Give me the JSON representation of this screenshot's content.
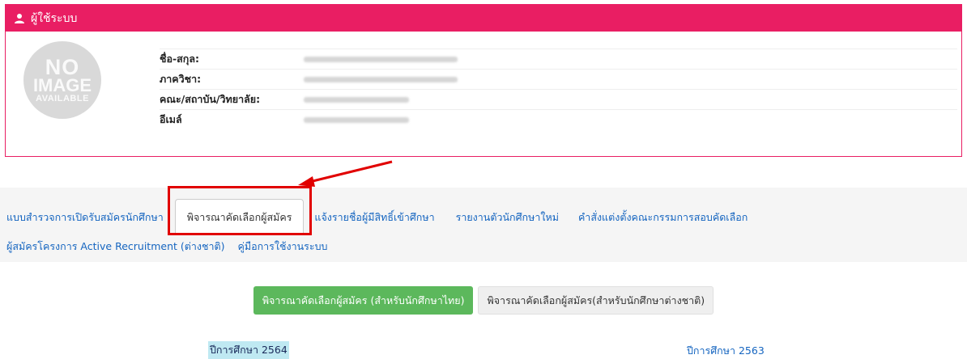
{
  "user_panel": {
    "header": "ผู้ใช้ระบบ",
    "photo": {
      "line1": "NO",
      "line2": "IMAGE",
      "line3": "AVAILABLE"
    },
    "fields": [
      {
        "label": "ชื่อ-สกุล:"
      },
      {
        "label": "ภาควิชา:"
      },
      {
        "label": "คณะ/สถาบัน/วิทยาลัย:"
      },
      {
        "label": "อีเมล์"
      }
    ]
  },
  "tabs": {
    "row1": [
      "แบบสำรวจการเปิดรับสมัครนักศึกษา",
      "พิจารณาคัดเลือกผู้สมัคร",
      "แจ้งรายชื่อผู้มีสิทธิ์เข้าศึกษา",
      "รายงานตัวนักศึกษาใหม่",
      "คำสั่งแต่งตั้งคณะกรรมการสอบคัดเลือก"
    ],
    "row2": [
      "ผู้สมัครโครงการ Active Recruitment (ต่างชาติ)",
      "คู่มือการใช้งานระบบ"
    ],
    "active_index": 1
  },
  "buttons": {
    "thai": "พิจารณาคัดเลือกผู้สมัคร (สำหรับนักศึกษาไทย)",
    "foreign": "พิจารณาคัดเลือกผู้สมัคร(สำหรับนักศึกษาต่างชาติ)"
  },
  "years": {
    "left": "ปีการศึกษา 2564",
    "right": "ปีการศึกษา 2563"
  },
  "colors": {
    "header_bg": "#e91e63",
    "link": "#1565c0",
    "button_green": "#5cb85c",
    "annotation_red": "#e10000"
  }
}
